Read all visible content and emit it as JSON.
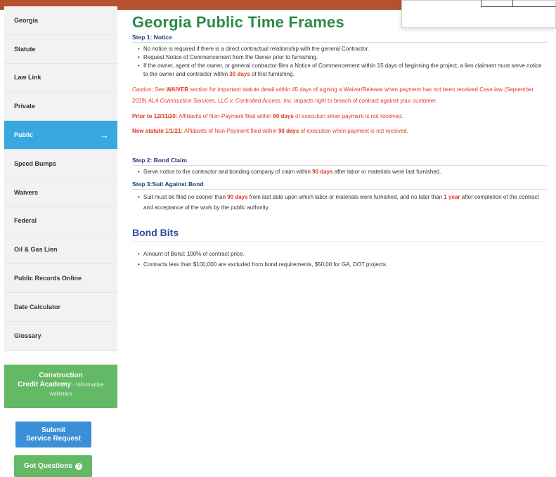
{
  "sidebar": {
    "items": [
      {
        "label": "Georgia"
      },
      {
        "label": "Statute"
      },
      {
        "label": "Law Link"
      },
      {
        "label": "Private"
      },
      {
        "label": "Public",
        "arrow": "→"
      },
      {
        "label": "Speed Bumps"
      },
      {
        "label": "Waivers"
      },
      {
        "label": "Federal"
      },
      {
        "label": "Oil & Gas Lien"
      },
      {
        "label": "Public Records Online"
      },
      {
        "label": "Date Calculator"
      },
      {
        "label": "Glossary"
      }
    ],
    "academy": {
      "line1": "Construction",
      "line2": "Credit Academy",
      "suffix": " - Informative",
      "line3": "webinars"
    },
    "submit_button": {
      "line1": "Submit",
      "line2": "Service Request"
    },
    "questions_button": {
      "label": "Got Questions",
      "icon": "?"
    }
  },
  "main": {
    "title": "Georgia Public Time Frames",
    "step1": {
      "heading": "Step 1: Notice",
      "bullet1": "No notice is required if there is a direct contractual relationship with the general Contractor.",
      "bullet2": "Request Notice of Commencement from the Owner prior to furnishing.",
      "bullet3_pre": "If the owner, agent of the owner, or general contractor files a Notice of Commencement within 15 days of beginning the project, a lien claimant must serve notice to the owner and contractor within ",
      "bullet3_days": "30 days",
      "bullet3_post": " of first furnishing."
    },
    "caution": {
      "pre": "Caution: See ",
      "waiver": "WAIVER",
      "mid": " section for important statute detail within 45 days of signing a Waiver/Release when payment has not been received Case law (September 2019) ",
      "case": "ALA Construction Services, LLC v. Controlled Access, Inc.",
      "post": " impacts right to breach of contract against your customer."
    },
    "prior": {
      "label": "Prior to 12/31/20:",
      "pre": " Affidavits of Non-Payment filed within ",
      "days": "60 days",
      "post": " of execution when payment is not received."
    },
    "new_statute": {
      "label": "New statute 1/1/21:",
      "pre": " Affidavits of Non-Payment filed within ",
      "days": "90 days",
      "post": " of execution when payment is not received."
    },
    "step2": {
      "heading": "Step 2: Bond Claim",
      "pre": "Serve notice to the contractor and bonding company of claim within ",
      "days": "90 days",
      "post": " after labor or materials were last furnished."
    },
    "step3": {
      "heading": "Step 3:Suit Against Bond",
      "pre": "Suit must be filed no sooner than ",
      "days": "90 days",
      "mid": " from last date upon which labor or materials were furnished, and no later than ",
      "year": "1 year",
      "post": " after completion of the contract and acceptance of the work by the public authority."
    },
    "bond_bits": {
      "title": "Bond Bits",
      "bullet1": "Amount of Bond: 100% of contract price.",
      "bullet2": "Contracts less than $100,000 are excluded from bond requirements, $50,00 for GA, DOT projects."
    }
  }
}
